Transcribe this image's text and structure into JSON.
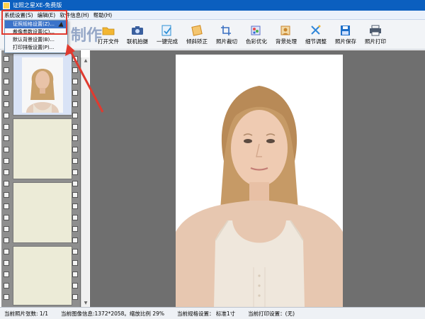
{
  "window": {
    "title": "证照之星XE-免费版"
  },
  "menubar": {
    "items": [
      "系统设置(S)",
      "编辑(E)",
      "软件信息(H)",
      "帮助(H)"
    ]
  },
  "dropdown": {
    "items": [
      "证照规格设置(Z)...",
      "裁像参数设置(C)...",
      "默认背景设置(B)...",
      "打印排版设置(P)..."
    ],
    "active_index": 0
  },
  "toolbar": {
    "watermark": "制作",
    "tools": [
      {
        "label": "打开文件",
        "icon": "folder-icon",
        "color": "#f2b632"
      },
      {
        "label": "联机拍摄",
        "icon": "camera-icon",
        "color": "#3a5f9e"
      },
      {
        "label": "一键完成",
        "icon": "one-click-icon",
        "color": "#2d8fd5"
      },
      {
        "label": "倾斜矫正",
        "icon": "tilt-correct-icon",
        "color": "#d08a1e"
      },
      {
        "label": "照片裁切",
        "icon": "crop-icon",
        "color": "#3a6fc2"
      },
      {
        "label": "色彩优化",
        "icon": "color-optimize-icon",
        "color": "#5b6ec9"
      },
      {
        "label": "背景处理",
        "icon": "background-icon",
        "color": "#c9852c"
      },
      {
        "label": "细节调整",
        "icon": "detail-adjust-icon",
        "color": "#2f86d8"
      },
      {
        "label": "照片保存",
        "icon": "save-icon",
        "color": "#1d6fc9"
      },
      {
        "label": "照片打印",
        "icon": "print-icon",
        "color": "#4c5a6e"
      }
    ]
  },
  "status": {
    "photo_count": "当前照片张数: 1/1",
    "image_info": "当前图像信息:1372*2058。缩放比例 29%",
    "spec": "当前规格设置： 标准1寸",
    "print_setting": "当前打印设置：(无)"
  },
  "colors": {
    "titlebar": "#0b5fbf",
    "highlight": "#e03a2f",
    "workspace": "#6f6f6f",
    "film": "#8e8e8e"
  }
}
